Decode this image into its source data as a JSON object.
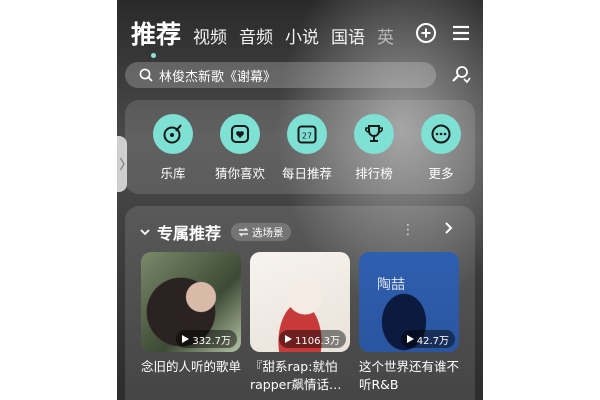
{
  "header": {
    "tabs": [
      {
        "label": "推荐",
        "active": true
      },
      {
        "label": "视频"
      },
      {
        "label": "音频"
      },
      {
        "label": "小说"
      },
      {
        "label": "国语"
      },
      {
        "label": "英"
      }
    ],
    "icons": [
      "add-icon",
      "menu-icon"
    ]
  },
  "search": {
    "text": "林俊杰新歌《谢幕》",
    "icon": "search-icon"
  },
  "quick_actions": [
    {
      "label": "乐库",
      "icon": "music-library-icon"
    },
    {
      "label": "猜你喜欢",
      "icon": "heart-icon"
    },
    {
      "label": "每日推荐",
      "icon": "calendar-icon",
      "badge": "27"
    },
    {
      "label": "排行榜",
      "icon": "trophy-icon"
    },
    {
      "label": "更多",
      "icon": "more-icon"
    }
  ],
  "recommend": {
    "title": "专属推荐",
    "scene_label": "选场景",
    "more": "⋮",
    "cards": [
      {
        "title": "念旧的人听的歌单",
        "plays": "332.7万"
      },
      {
        "title": "『甜系rap:就怕rapper飙情话…",
        "plays": "1106.3万"
      },
      {
        "title": "这个世界还有谁不听R&B",
        "plays": "42.7万",
        "cover_text": "陶喆"
      }
    ]
  },
  "colors": {
    "accent": "#7fe0d4",
    "tab_dot": "#8fe3d8"
  }
}
